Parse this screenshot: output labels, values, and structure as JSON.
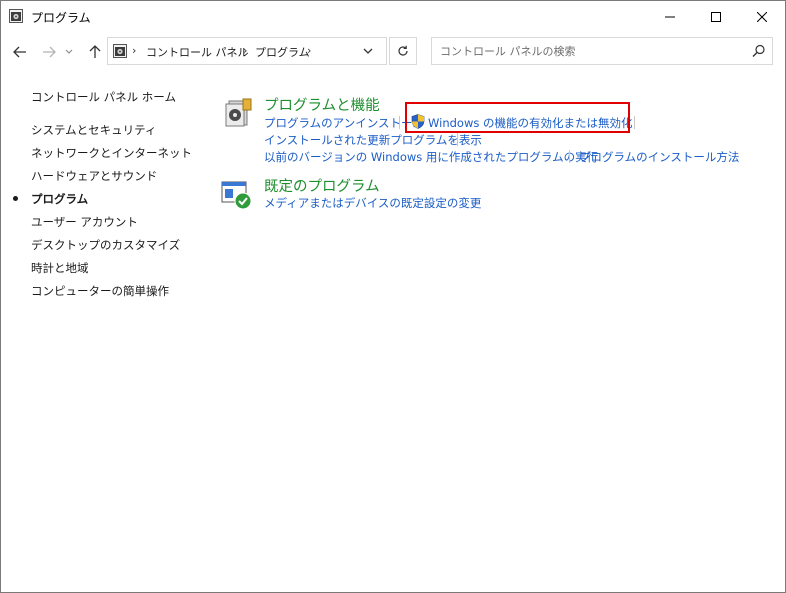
{
  "window": {
    "title": "プログラム",
    "controls": [
      "minimize",
      "maximize",
      "close"
    ]
  },
  "nav": {
    "breadcrumb": [
      "コントロール パネル",
      "プログラム"
    ],
    "search_placeholder": "コントロール パネルの検索"
  },
  "sidebar": {
    "home": "コントロール パネル ホーム",
    "items": [
      {
        "label": "システムとセキュリティ",
        "active": false
      },
      {
        "label": "ネットワークとインターネット",
        "active": false
      },
      {
        "label": "ハードウェアとサウンド",
        "active": false
      },
      {
        "label": "プログラム",
        "active": true
      },
      {
        "label": "ユーザー アカウント",
        "active": false
      },
      {
        "label": "デスクトップのカスタマイズ",
        "active": false
      },
      {
        "label": "時計と地域",
        "active": false
      },
      {
        "label": "コンピューターの簡単操作",
        "active": false
      }
    ]
  },
  "main": {
    "categories": [
      {
        "title": "プログラムと機能",
        "icon": "programs-features-icon",
        "links": [
          "プログラムのアンインストール",
          "Windows の機能の有効化または無効化",
          "インストールされた更新プログラムを表示",
          "以前のバージョンの Windows 用に作成されたプログラムの実行",
          "プログラムのインストール方法"
        ]
      },
      {
        "title": "既定のプログラム",
        "icon": "default-programs-icon",
        "links": [
          "メディアまたはデバイスの既定設定の変更"
        ]
      }
    ]
  },
  "colors": {
    "category_title": "#1e8f2e",
    "link": "#1a5cc7",
    "highlight": "#e00000"
  }
}
